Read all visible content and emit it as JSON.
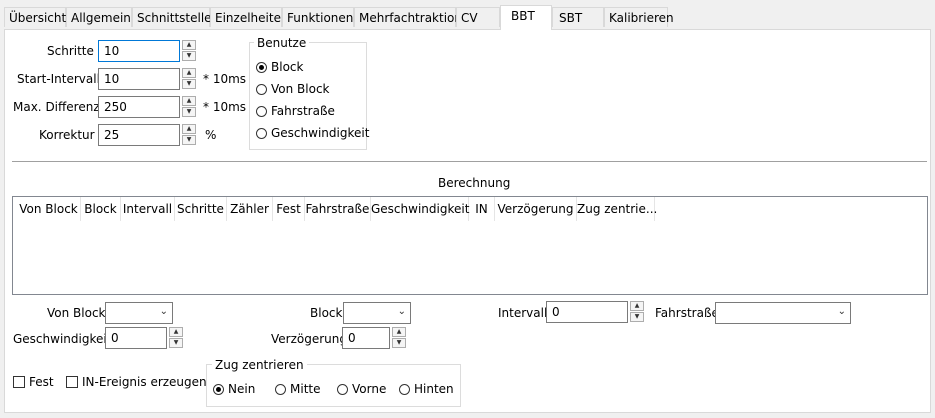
{
  "tabs": [
    "Übersicht",
    "Allgemein",
    "Schnittstelle",
    "Einzelheiten",
    "Funktionen",
    "Mehrfachtraktion",
    "CV",
    "BBT",
    "SBT",
    "Kalibrieren"
  ],
  "active_tab": "BBT",
  "params": {
    "schritte_label": "Schritte",
    "schritte_value": "10",
    "start_label": "Start-Intervall",
    "start_value": "10",
    "start_unit": "* 10ms",
    "maxdiff_label": "Max. Differenz",
    "maxdiff_value": "250",
    "maxdiff_unit": "* 10ms",
    "korrektur_label": "Korrektur",
    "korrektur_value": "25",
    "korrektur_unit": "%"
  },
  "benutze": {
    "title": "Benutze",
    "options": [
      "Block",
      "Von Block",
      "Fahrstraße",
      "Geschwindigkeit"
    ],
    "selected": "Block"
  },
  "berechnung": {
    "title": "Berechnung",
    "columns": [
      "Von Block",
      "Block",
      "Intervall",
      "Schritte",
      "Zähler",
      "Fest",
      "Fahrstraße",
      "Geschwindigkeit",
      "IN",
      "Verzögerung",
      "Zug zentrie..."
    ]
  },
  "form": {
    "von_block_label": "Von Block",
    "von_block_value": "",
    "block_label": "Block",
    "block_value": "",
    "intervall_label": "Intervall",
    "intervall_value": "0",
    "fahrstrasse_label": "Fahrstraße",
    "fahrstrasse_value": "",
    "geschwindigkeit_label": "Geschwindigkeit",
    "geschwindigkeit_value": "0",
    "verzoegerung_label": "Verzögerung",
    "verzoegerung_value": "0"
  },
  "checks": {
    "fest_label": "Fest",
    "fest_checked": false,
    "in_label": "IN-Ereignis erzeugen",
    "in_checked": false
  },
  "zug_zentrieren": {
    "title": "Zug zentrieren",
    "options": [
      "Nein",
      "Mitte",
      "Vorne",
      "Hinten"
    ],
    "selected": "Nein"
  }
}
